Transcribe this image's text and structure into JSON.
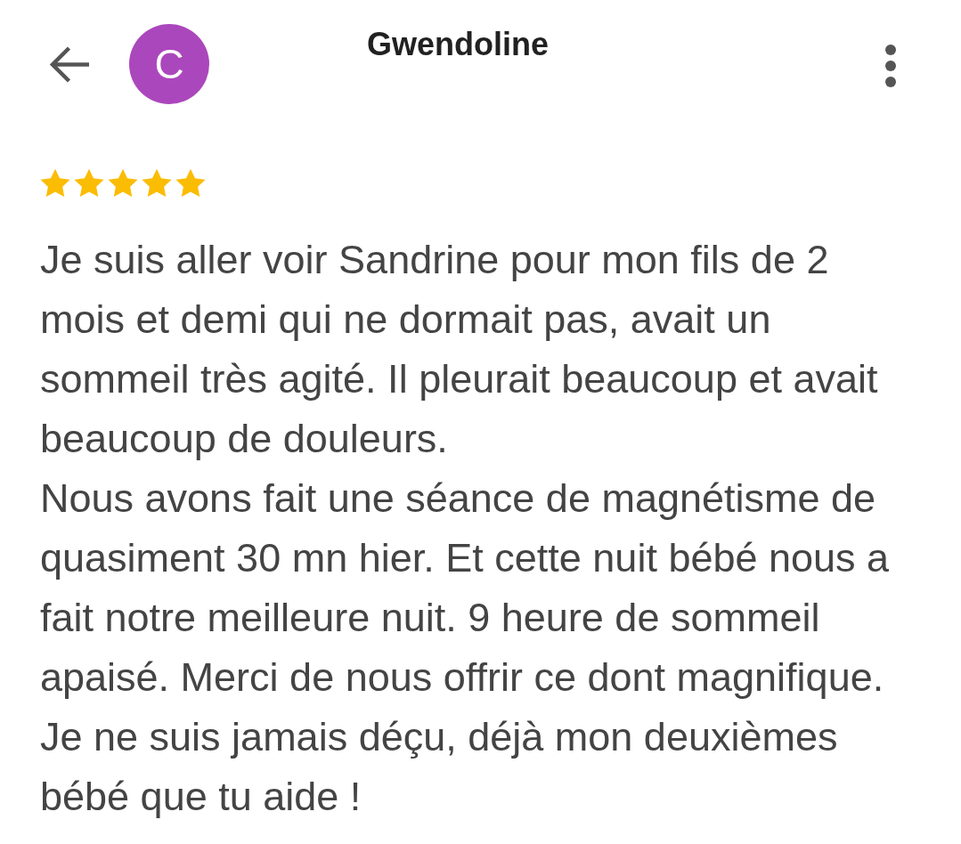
{
  "header": {
    "avatar_letter": "C",
    "reviewer_name": "Gwendoline"
  },
  "review": {
    "stars": 5,
    "paragraphs": [
      "Je suis aller voir Sandrine pour mon fils de 2 mois et demi qui ne dormait pas, avait un sommeil très agité. Il pleurait beaucoup et avait beaucoup de douleurs.",
      "Nous avons fait une séance de magnétisme de quasiment 30 mn hier. Et cette nuit bébé nous a fait notre meilleure nuit. 9 heure de sommeil apaisé. Merci de nous offrir ce dont magnifique. Je ne suis jamais déçu, déjà mon deuxièmes bébé que tu aide !"
    ]
  }
}
